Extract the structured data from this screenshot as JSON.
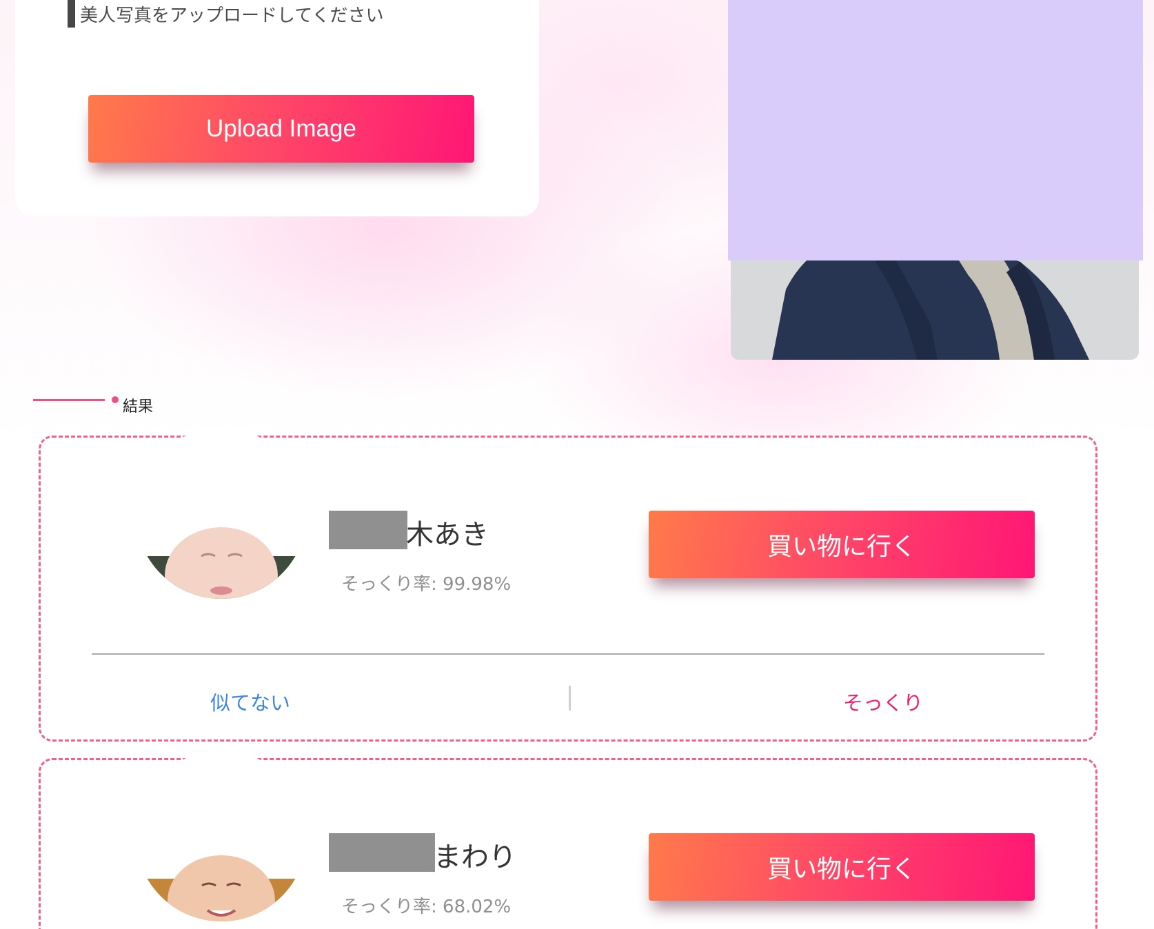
{
  "upload": {
    "prompt": "美人写真をアップロードしてください",
    "button_label": "Upload Image"
  },
  "results": {
    "title": "結果",
    "items": [
      {
        "name_visible": "木あき",
        "rate_text": "そっくり率: 99.98%",
        "shop_label": "買い物に行く",
        "vote_no": "似てない",
        "vote_yes": "そっくり"
      },
      {
        "name_visible": "まわり",
        "rate_text": "そっくり率: 68.02%",
        "shop_label": "買い物に行く"
      }
    ]
  },
  "colors": {
    "accent_pink": "#ff1675",
    "accent_orange": "#ff7a4a",
    "dashed_border": "#f25f87",
    "vote_no": "#3f87d9",
    "vote_yes": "#f01d6b",
    "redaction": "#d9ccfb"
  }
}
